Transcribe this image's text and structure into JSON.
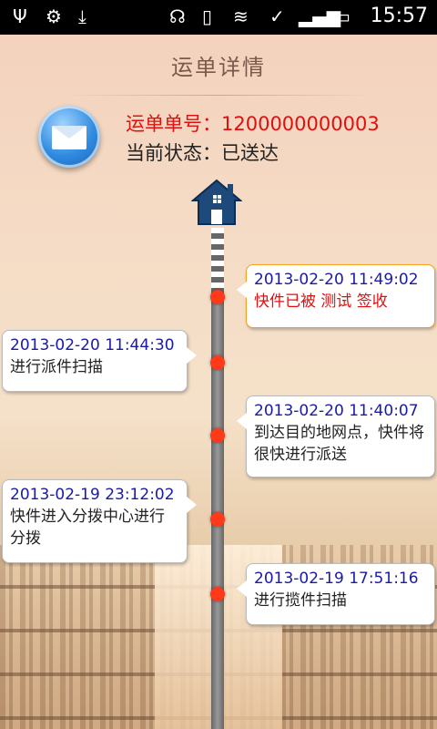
{
  "status_bar": {
    "time": "15:57",
    "left_icons": [
      "usb-icon",
      "android-debug-icon",
      "download-icon"
    ],
    "right_icons": [
      "headset-icon",
      "vibrate-icon",
      "wifi-icon",
      "sync-icon",
      "signal-icon",
      "battery-charging-icon"
    ]
  },
  "header": {
    "title": "运单详情"
  },
  "order": {
    "number_line": "运单单号：1200000000003",
    "status_line": "当前状态：已送达"
  },
  "timeline": [
    {
      "time": "2013-02-20 11:49:02",
      "desc": "快件已被 测试 签收",
      "side": "right",
      "highlight": true
    },
    {
      "time": "2013-02-20 11:44:30",
      "desc": "进行派件扫描",
      "side": "left",
      "highlight": false
    },
    {
      "time": "2013-02-20 11:40:07",
      "desc": "到达目的地网点，快件将很快进行派送",
      "side": "right",
      "highlight": false
    },
    {
      "time": "2013-02-19 23:12:02",
      "desc": "快件进入分拨中心进行分拨",
      "side": "left",
      "highlight": false
    },
    {
      "time": "2013-02-19 17:51:16",
      "desc": "进行揽件扫描",
      "side": "right",
      "highlight": false
    }
  ],
  "colors": {
    "accent_red": "#e01010",
    "time_blue": "#1a1aa8",
    "dot": "#ff3a1a"
  }
}
